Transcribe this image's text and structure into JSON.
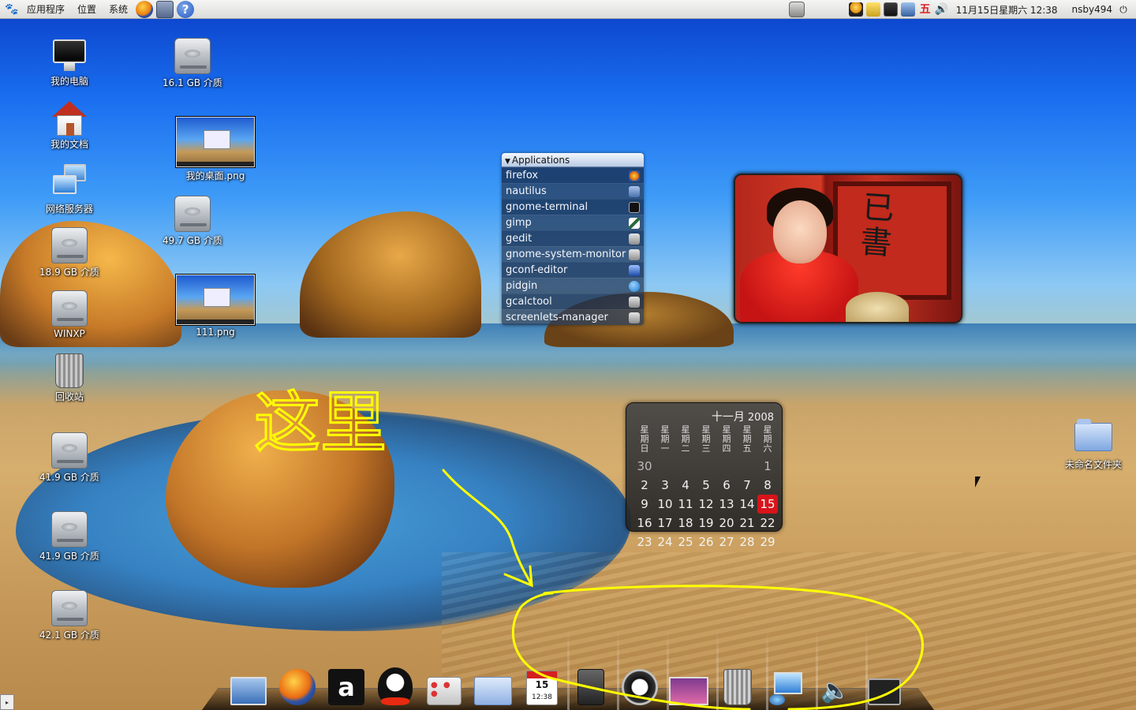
{
  "top_panel": {
    "menus": [
      "应用程序",
      "位置",
      "系统"
    ],
    "launchers": [
      "firefox-icon",
      "text-editor-icon",
      "help-icon"
    ],
    "tray_icons": [
      "qq-icon",
      "notify-icon",
      "screen-icon",
      "network-icon"
    ],
    "input_method_char": "五",
    "clock": "11月15日星期六 12:38",
    "user": "nsby494"
  },
  "desktop_icons": [
    {
      "label": "我的电脑",
      "icon": "computer-icon"
    },
    {
      "label": "16.1 GB 介质",
      "icon": "drive-icon"
    },
    {
      "label": "我的文档",
      "icon": "home-icon"
    },
    {
      "label": "我的桌面.png",
      "icon": "image-thumbnail"
    },
    {
      "label": "网络服务器",
      "icon": "network-server-icon"
    },
    {
      "label": "49.7 GB 介质",
      "icon": "drive-icon"
    },
    {
      "label": "18.9 GB 介质",
      "icon": "drive-icon"
    },
    {
      "label": "WINXP",
      "icon": "drive-icon"
    },
    {
      "label": "111.png",
      "icon": "image-thumbnail"
    },
    {
      "label": "回收站",
      "icon": "trash-icon"
    },
    {
      "label": "41.9 GB 介质",
      "icon": "drive-icon"
    },
    {
      "label": "41.9 GB 介质",
      "icon": "drive-icon"
    },
    {
      "label": "42.1 GB 介质",
      "icon": "drive-icon"
    },
    {
      "label": "未命名文件夹",
      "icon": "folder-icon"
    }
  ],
  "applications": {
    "title": "Applications",
    "items": [
      {
        "name": "firefox",
        "icon": "firefox-icon"
      },
      {
        "name": "nautilus",
        "icon": "nautilus-icon"
      },
      {
        "name": "gnome-terminal",
        "icon": "terminal-icon"
      },
      {
        "name": "gimp",
        "icon": "gimp-icon"
      },
      {
        "name": "gedit",
        "icon": "gear-icon"
      },
      {
        "name": "gnome-system-monitor",
        "icon": "gear-icon"
      },
      {
        "name": "gconf-editor",
        "icon": "gconf-icon"
      },
      {
        "name": "pidgin",
        "icon": "pidgin-icon"
      },
      {
        "name": "gcalctool",
        "icon": "calculator-icon"
      },
      {
        "name": "screenlets-manager",
        "icon": "gear-icon"
      }
    ]
  },
  "calendar": {
    "month": "十一月",
    "year": "2008",
    "weekdays": [
      "星期日",
      "星期一",
      "星期二",
      "星期三",
      "星期四",
      "星期五",
      "星期六"
    ],
    "weeks": [
      [
        "30",
        "",
        "",
        "",
        "",
        "",
        "1"
      ],
      [
        "2",
        "3",
        "4",
        "5",
        "6",
        "7",
        "8"
      ],
      [
        "9",
        "10",
        "11",
        "12",
        "13",
        "14",
        "15"
      ],
      [
        "16",
        "17",
        "18",
        "19",
        "20",
        "21",
        "22"
      ],
      [
        "23",
        "24",
        "25",
        "26",
        "27",
        "28",
        "29"
      ]
    ],
    "today": "15",
    "today_color": "#d8141a"
  },
  "dock": {
    "items": [
      "desktop-icon",
      "firefox-icon",
      "a-icon",
      "qq-icon",
      "network-settings-icon",
      "folder-icon",
      "ical-icon",
      "speaker-icon",
      "power-icon",
      "photo-icon",
      "trash-icon",
      "computer-icon",
      "volume-icon",
      "terminal-icon"
    ],
    "ical_day": "15",
    "ical_time": "12:38"
  },
  "annotation": {
    "color": "#ffff00",
    "handwriting": "这里"
  }
}
